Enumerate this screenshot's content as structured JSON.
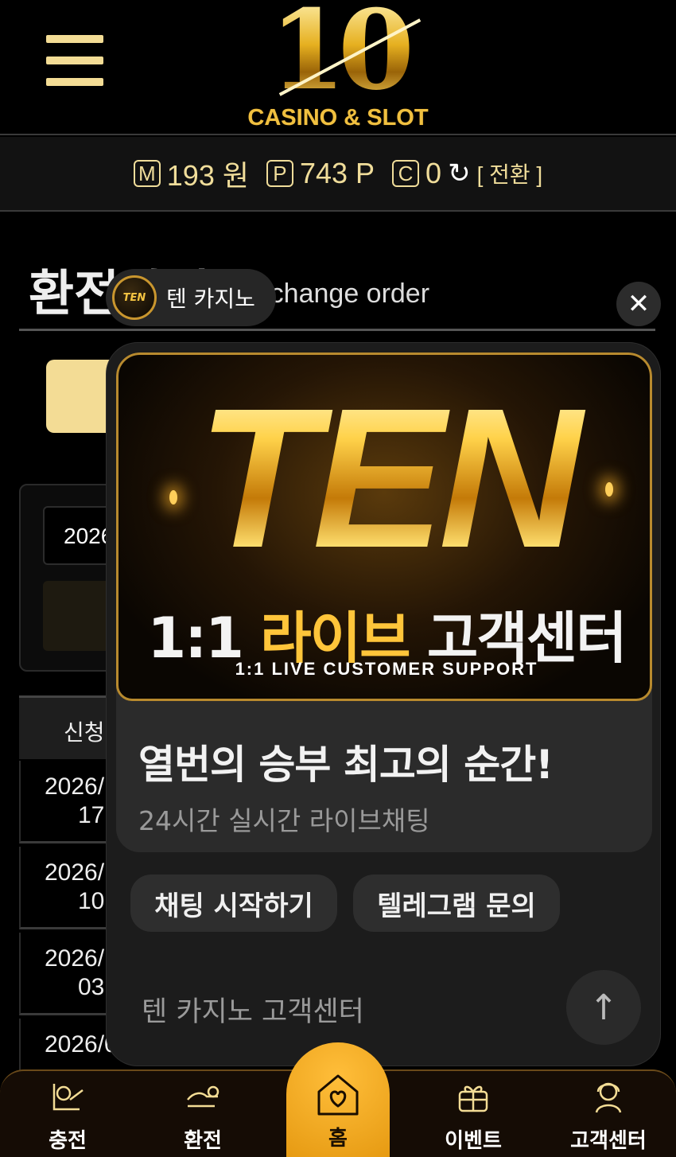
{
  "header": {
    "logo_number": "10",
    "logo_subtitle": "CASINO & SLOT"
  },
  "balance": {
    "money_icon": "M",
    "money_value": "193 원",
    "point_icon": "P",
    "point_value": "743 P",
    "coin_icon": "C",
    "coin_value": "0",
    "refresh_icon": "refresh-icon",
    "switch_label": "[ 전환 ]"
  },
  "page": {
    "title": "환전하기",
    "subtitle": "Exchange order",
    "date_value": "2026",
    "table_header": "신청",
    "rows": [
      {
        "date": "2026/",
        "time": "17"
      },
      {
        "date": "2026/",
        "time": "10"
      },
      {
        "date": "2026/",
        "time": "03"
      },
      {
        "date": "2026/0",
        "time": ""
      }
    ]
  },
  "chat": {
    "agent_name": "텐 카지노",
    "agent_avatar_text": "TEN",
    "banner_title": "TEN",
    "banner_kr_prefix": "1:1",
    "banner_kr_gold": "라이브",
    "banner_kr_suffix": "고객센터",
    "banner_en": "1:1 LIVE CUSTOMER SUPPORT",
    "headline": "열번의 승부 최고의 순간!",
    "subtext": "24시간 실시간 라이브채팅",
    "start_chat_label": "채팅 시작하기",
    "telegram_label": "텔레그램 문의",
    "footer_label": "텐 카지노 고객센터",
    "close_icon": "close-icon",
    "scroll_icon": "arrow-up-icon"
  },
  "nav": {
    "deposit": "충전",
    "withdraw": "환전",
    "home": "홈",
    "event": "이벤트",
    "support": "고객센터"
  },
  "colors": {
    "gold": "#f3dc95",
    "home_orange": "#f2a81c",
    "panel_bg": "#1c1c1c"
  }
}
